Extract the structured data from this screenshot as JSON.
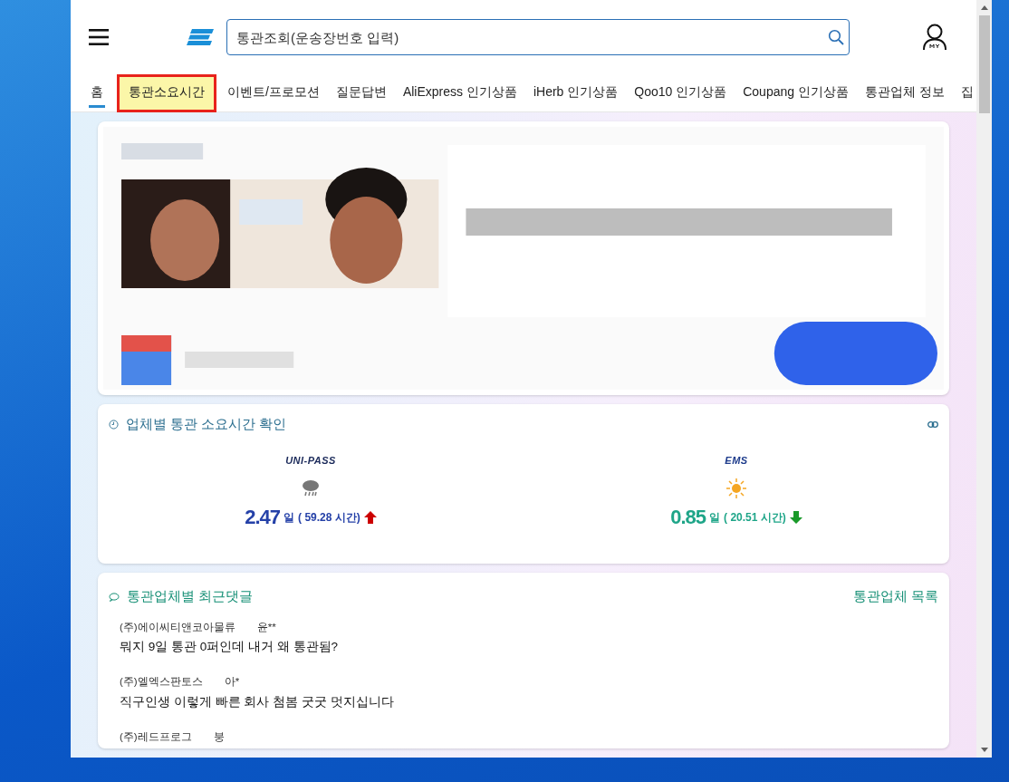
{
  "header": {
    "search": {
      "placeholder": "통관조회(운송장번호 입력)"
    }
  },
  "tabs": [
    {
      "label": "홈",
      "selected": true,
      "highlighted": false
    },
    {
      "label": "통관소요시간",
      "selected": false,
      "highlighted": true
    },
    {
      "label": "이벤트/프로모션",
      "selected": false,
      "highlighted": false
    },
    {
      "label": "질문답변",
      "selected": false,
      "highlighted": false
    },
    {
      "label": "AliExpress 인기상품",
      "selected": false,
      "highlighted": false
    },
    {
      "label": "iHerb 인기상품",
      "selected": false,
      "highlighted": false
    },
    {
      "label": "Qoo10 인기상품",
      "selected": false,
      "highlighted": false
    },
    {
      "label": "Coupang 인기상품",
      "selected": false,
      "highlighted": false
    },
    {
      "label": "통관업체 정보",
      "selected": false,
      "highlighted": false
    },
    {
      "label": "집",
      "selected": false,
      "highlighted": false
    }
  ],
  "customs_time": {
    "title": "업체별 통관 소요시간 확인",
    "carriers": [
      {
        "logo": "UNI-PASS",
        "weather": {
          "kind": "rain"
        },
        "days": "2.47",
        "unit": "일",
        "hours": "( 59.28 시간)",
        "trend": {
          "kind": "up"
        },
        "color": "#2541a8"
      },
      {
        "logo": "EMS",
        "weather": {
          "kind": "sun"
        },
        "days": "0.85",
        "unit": "일",
        "hours": "( 20.51 시간)",
        "trend": {
          "kind": "down"
        },
        "color": "#1ea588"
      }
    ]
  },
  "comments": {
    "title": "통관업체별 최근댓글",
    "link": "통관업체 목록",
    "items": [
      {
        "company": "(주)에이씨티앤코아물류",
        "author": "윤**",
        "text": "뭐지 9일 통관 0퍼인데 내거 왜 통관됨?"
      },
      {
        "company": "(주)엘엑스판토스",
        "author": "아*",
        "text": "직구인생 이렇게 빠른 회사 첨봄 굿굿 멋지십니다"
      },
      {
        "company": "(주)레드프로그",
        "author": "붕"
      }
    ]
  }
}
